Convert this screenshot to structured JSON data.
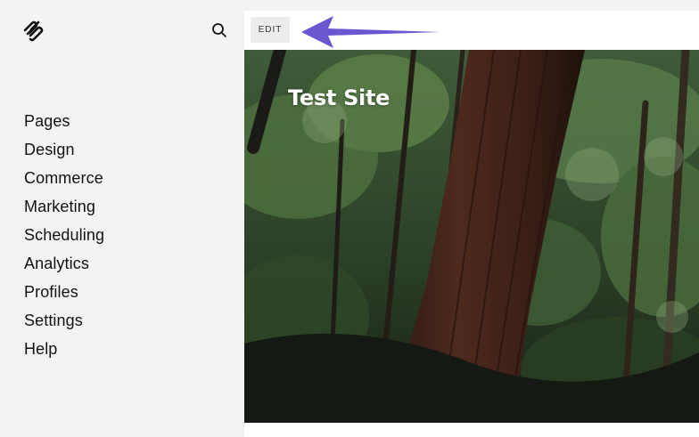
{
  "sidebar": {
    "logo_icon": "squarespace-logo-icon",
    "search_icon": "search-icon",
    "items": [
      {
        "label": "Pages"
      },
      {
        "label": "Design"
      },
      {
        "label": "Commerce"
      },
      {
        "label": "Marketing"
      },
      {
        "label": "Scheduling"
      },
      {
        "label": "Analytics"
      },
      {
        "label": "Profiles"
      },
      {
        "label": "Settings"
      },
      {
        "label": "Help"
      }
    ]
  },
  "preview": {
    "edit_label": "EDIT",
    "site_title": "Test Site",
    "annotation_arrow_color": "#6a56cf",
    "hero_image": "redwood-forest-photo"
  }
}
